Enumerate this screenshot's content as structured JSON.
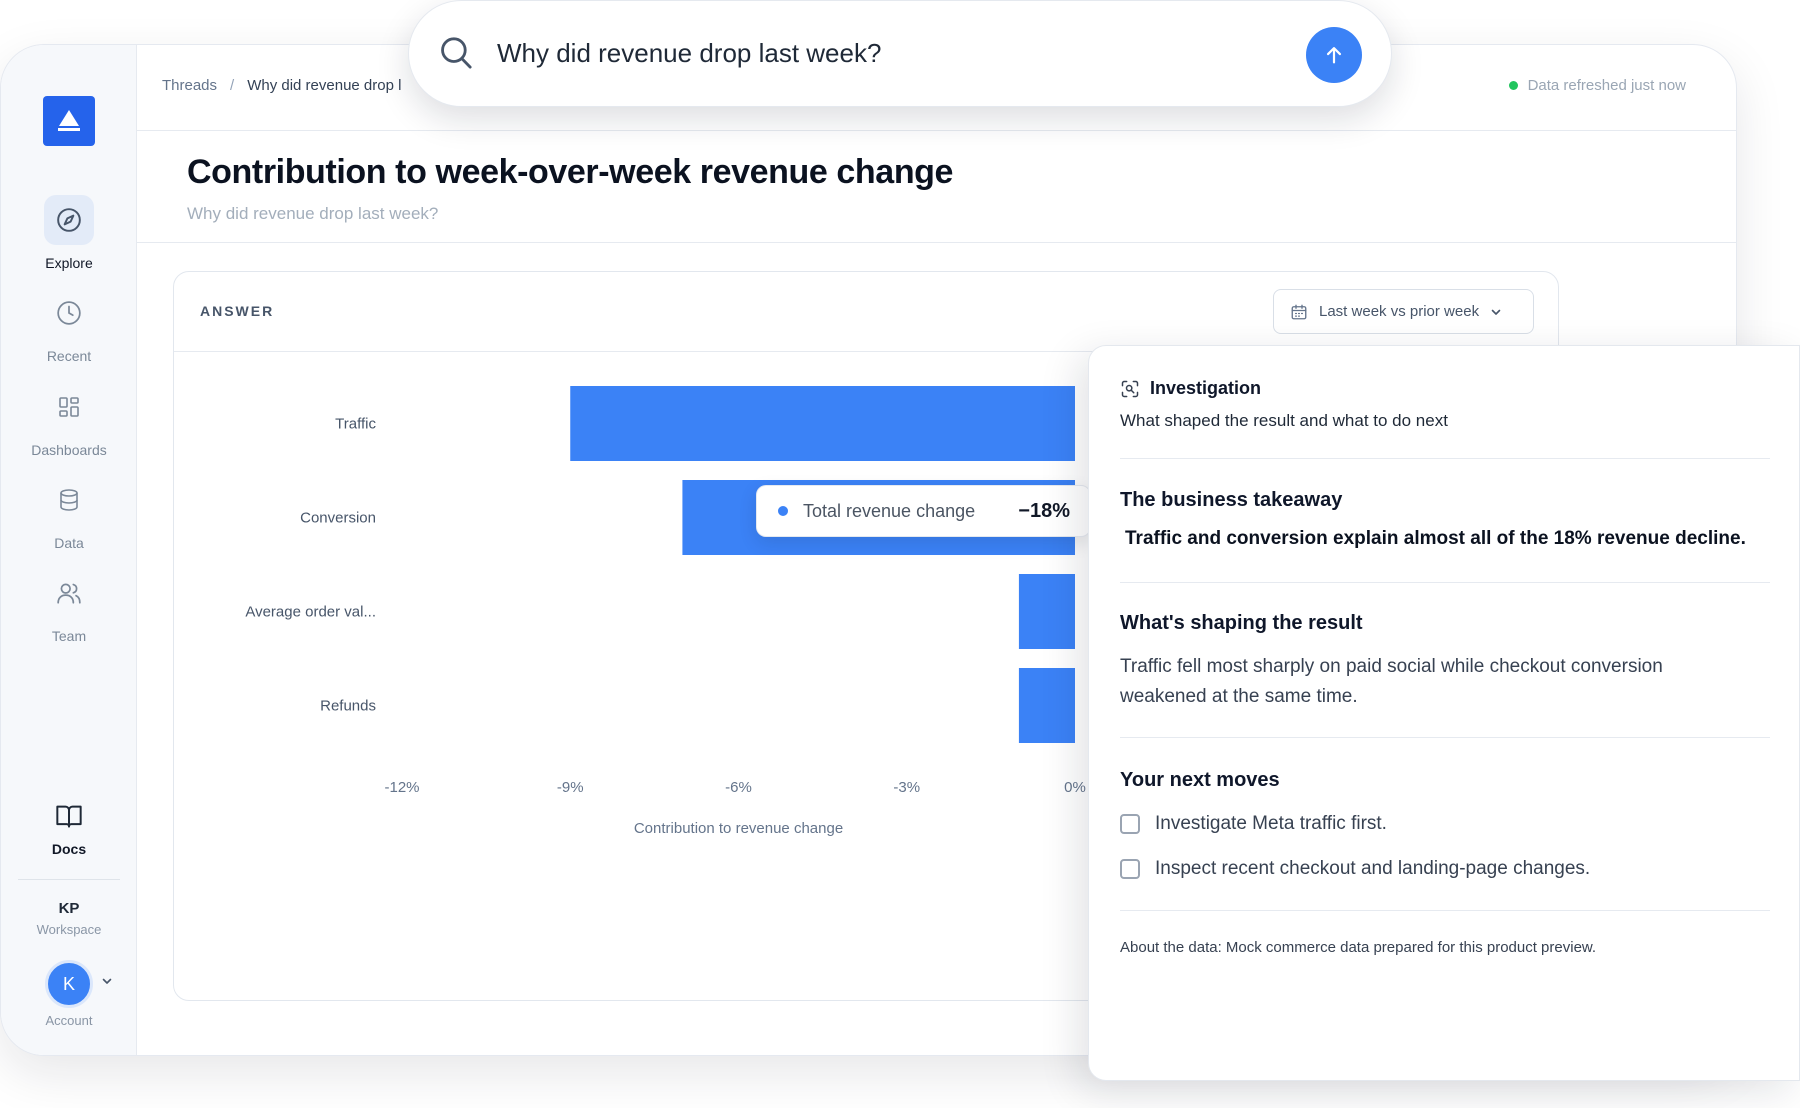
{
  "search": {
    "query": "Why did revenue drop last week?"
  },
  "sidebar": {
    "items": [
      {
        "label": "Explore",
        "icon": "compass-icon"
      },
      {
        "label": "Recent",
        "icon": "clock-icon"
      },
      {
        "label": "Dashboards",
        "icon": "grid-icon"
      },
      {
        "label": "Data",
        "icon": "database-icon"
      },
      {
        "label": "Team",
        "icon": "users-icon"
      }
    ],
    "docs_label": "Docs",
    "workspace_initials": "KP",
    "workspace_label": "Workspace",
    "avatar_initial": "K",
    "account_label": "Account"
  },
  "topbar": {
    "breadcrumb_root": "Threads",
    "breadcrumb_separator": "/",
    "breadcrumb_current": "Why did revenue drop l",
    "refresh_status": "Data refreshed just now"
  },
  "page": {
    "title": "Contribution to week-over-week revenue change",
    "subtitle": "Why did revenue drop last week?"
  },
  "answer": {
    "label": "ANSWER",
    "period": "Last week vs prior week"
  },
  "chart_data": {
    "type": "bar",
    "orientation": "horizontal",
    "categories": [
      "Traffic",
      "Conversion",
      "Average order val...",
      "Refunds"
    ],
    "values": [
      -9,
      -7,
      -1,
      -1
    ],
    "xlabel": "Contribution to revenue change",
    "ylabel": "",
    "xlim": [
      -12,
      0
    ],
    "ticks": [
      "-12%",
      "-9%",
      "-6%",
      "-3%",
      "0%"
    ],
    "tick_values": [
      -12,
      -9,
      -6,
      -3,
      0
    ],
    "bar_color": "#3b82f6",
    "grid": false
  },
  "tooltip": {
    "label": "Total revenue change",
    "value": "−18%"
  },
  "panel": {
    "title": "Investigation",
    "description": "What shaped the result and what to do next",
    "takeaway_title": "The business takeaway",
    "takeaway_text": "Traffic and conversion explain almost all of the 18% revenue decline.",
    "shaping_title": "What's shaping the result",
    "shaping_text": "Traffic fell most sharply on paid social while checkout conversion weakened at the same time.",
    "moves_title": "Your next moves",
    "moves": [
      "Investigate Meta traffic first.",
      "Inspect recent checkout and landing-page changes."
    ],
    "about": "About the data: Mock commerce data prepared for this product preview."
  },
  "colors": {
    "accent": "#3b82f6",
    "logo": "#2563eb",
    "status_ok": "#22c55e"
  }
}
